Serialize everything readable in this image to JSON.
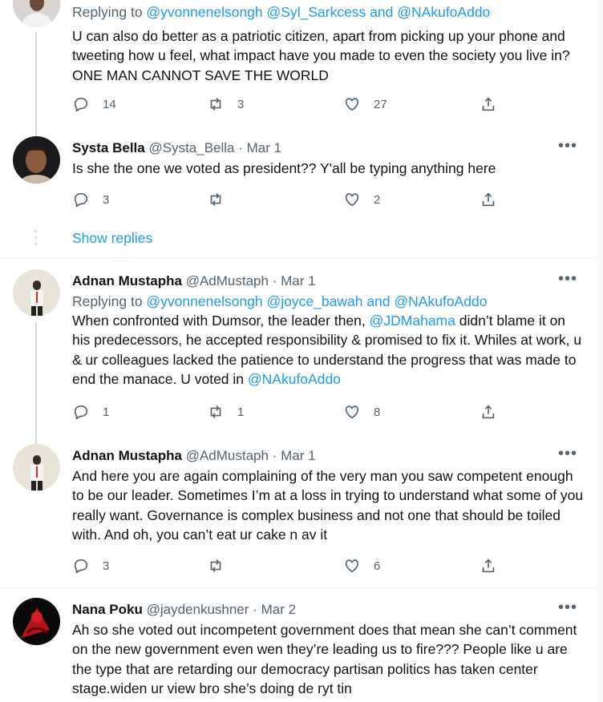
{
  "tweets": [
    {
      "reply_prefix": "Replying to ",
      "reply_to": [
        "@yvonnenelsongh",
        "@Syl_Sarkcess",
        "and",
        "@NAkufoAddo"
      ],
      "text": "U can also do better as a patriotic citizen, apart from picking up your phone and tweeting how u feel, what impact have you made to even the society you live in? ONE MAN CANNOT SAVE THE WORLD",
      "replies": "14",
      "retweets": "3",
      "likes": "27"
    },
    {
      "name": "Systa Bella",
      "handle": "@Systa_Bella",
      "dot": "·",
      "date": "Mar 1",
      "text": "Is she the one we voted as president?? Y'all be typing anything here",
      "replies": "3",
      "retweets": "",
      "likes": "2"
    },
    {
      "name": "Adnan Mustapha",
      "handle": "@AdMustaph",
      "dot": "·",
      "date": "Mar 1",
      "reply_prefix": "Replying to ",
      "reply_to": [
        "@yvonnenelsongh",
        "@joyce_bawah",
        "and",
        "@NAkufoAddo"
      ],
      "text_parts": [
        "When confronted with Dumsor, the leader then, ",
        "@JDMahama",
        " didn’t blame it on his predecessors, he accepted responsibility & promised to fix it. Whiles at work, u & ur colleagues lacked the patience to understand the progress that was made to end the manace. U voted in ",
        "@NAkufoAddo"
      ],
      "replies": "1",
      "retweets": "1",
      "likes": "8"
    },
    {
      "name": "Adnan Mustapha",
      "handle": "@AdMustaph",
      "dot": "·",
      "date": "Mar 1",
      "text": "And here you are again complaining of the very man you saw competent enough to be our leader. Sometimes I’m at a loss in trying to understand what some of you really want. Governance is complex business and not one that should be toiled with. And oh, you can’t eat ur cake n av it",
      "replies": "3",
      "retweets": "",
      "likes": "6"
    },
    {
      "name": "Nana Poku",
      "handle": "@jaydenkushner",
      "dot": "·",
      "date": "Mar 2",
      "text": "Ah so she voted out incompetent government does that mean she can’t comment on the new government even wen they’re leading us to fire??? People like u are the type that are retarding our democracy partisan politics has taken center stage.widen ur view bro she’s doing de ryt tin"
    }
  ],
  "show_replies": "Show replies",
  "more_label": "•••",
  "colors": {
    "link": "#1d9bf0",
    "muted": "#536471",
    "divider": "#eff3f4"
  }
}
